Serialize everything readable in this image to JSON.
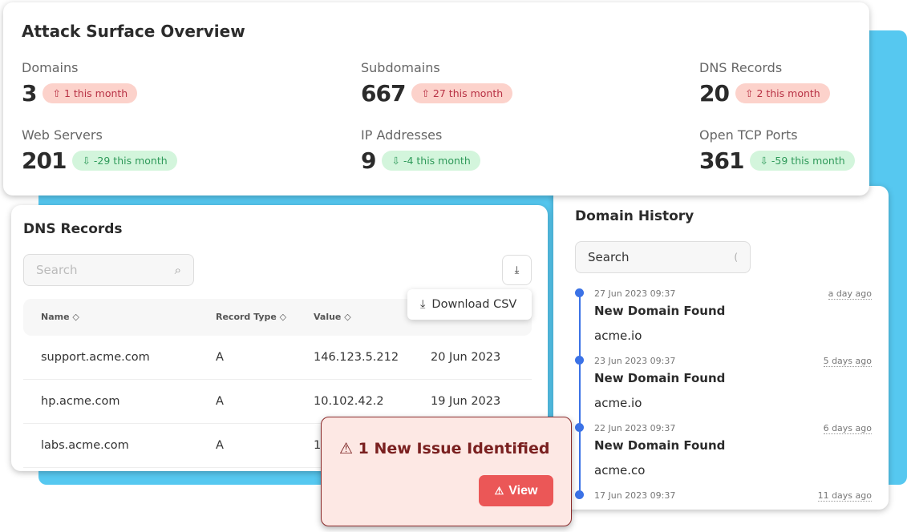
{
  "overview": {
    "title": "Attack Surface Overview",
    "stats": [
      {
        "label": "Domains",
        "value": "3",
        "change": "1 this month",
        "trend": "up"
      },
      {
        "label": "Subdomains",
        "value": "667",
        "change": "27 this month",
        "trend": "up"
      },
      {
        "label": "DNS Records",
        "value": "20",
        "change": "2 this month",
        "trend": "up"
      },
      {
        "label": "Web Servers",
        "value": "201",
        "change": "-29 this month",
        "trend": "down"
      },
      {
        "label": "IP Addresses",
        "value": "9",
        "change": "-4 this month",
        "trend": "down"
      },
      {
        "label": "Open TCP Ports",
        "value": "361",
        "change": "-59 this month",
        "trend": "down"
      }
    ]
  },
  "dns": {
    "title": "DNS Records",
    "search_placeholder": "Search",
    "download_csv": "Download CSV",
    "columns": [
      "Name",
      "Record Type",
      "Value"
    ],
    "rows": [
      [
        "support.acme.com",
        "A",
        "146.123.5.212",
        "20 Jun 2023"
      ],
      [
        "hp.acme.com",
        "A",
        "10.102.42.2",
        "19 Jun 2023"
      ],
      [
        "labs.acme.com",
        "A",
        "14",
        ""
      ]
    ]
  },
  "history": {
    "title": "Domain History",
    "search_value": "Search",
    "events": [
      {
        "timestamp": "27 Jun 2023 09:37",
        "ago": "a day ago",
        "title": "New Domain Found",
        "domain": "acme.io"
      },
      {
        "timestamp": "23 Jun 2023 09:37",
        "ago": "5 days ago",
        "title": "New Domain Found",
        "domain": "acme.io"
      },
      {
        "timestamp": "22 Jun 2023 09:37",
        "ago": "6 days ago",
        "title": "New Domain Found",
        "domain": "acme.co"
      },
      {
        "timestamp": "17 Jun 2023 09:37",
        "ago": "11 days ago"
      }
    ]
  },
  "alert": {
    "message": "1 New Issue Identified",
    "view_label": "View"
  },
  "colors": {
    "accent_blue": "#56c8f0",
    "timeline": "#3b72e6",
    "alert_button": "#eb5757"
  }
}
